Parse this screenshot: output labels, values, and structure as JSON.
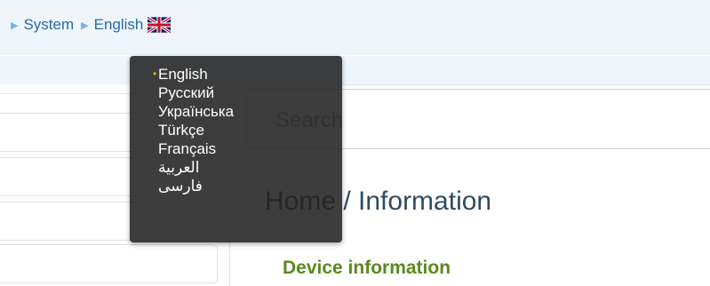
{
  "breadcrumb": {
    "items": [
      "System",
      "English"
    ],
    "flag_icon": "uk-flag-icon"
  },
  "language_menu": {
    "selected": "English",
    "items": [
      {
        "label": "English",
        "selected": true
      },
      {
        "label": "Русский",
        "selected": false
      },
      {
        "label": "Українська",
        "selected": false
      },
      {
        "label": "Türkçe",
        "selected": false
      },
      {
        "label": "Français",
        "selected": false
      },
      {
        "label": "العربية",
        "selected": false
      },
      {
        "label": "فارسی",
        "selected": false
      }
    ],
    "bullet": "•"
  },
  "search": {
    "placeholder": "Search"
  },
  "main": {
    "page_title": "Home /  Information",
    "section_title": "Device information"
  },
  "colors": {
    "topbar_bg": "#eef5fb",
    "link": "#2b6aa6",
    "title": "#2f4b63",
    "section": "#5b8a1d",
    "menu_bg": "#222222",
    "bullet": "#f0b400"
  }
}
